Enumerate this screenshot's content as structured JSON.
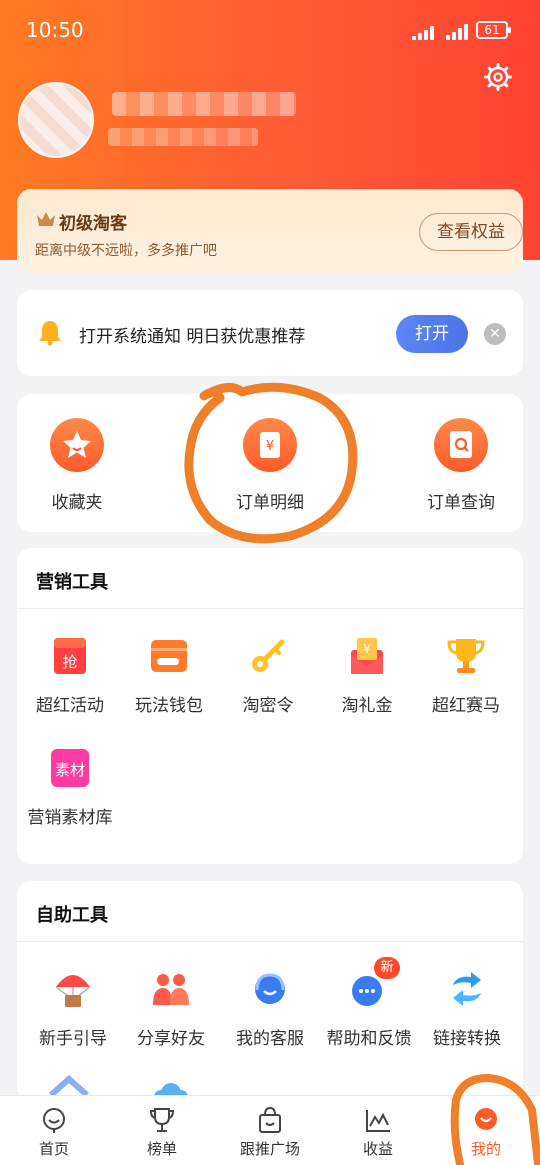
{
  "status_bar": {
    "time": "10:50",
    "battery": "61"
  },
  "profile": {},
  "level": {
    "title": "初级淘客",
    "subtitle": "距离中级不远啦，多多推广吧",
    "button": "查看权益"
  },
  "notice": {
    "text": "打开系统通知 明日获优惠推荐",
    "button": "打开"
  },
  "orders": [
    {
      "label": "收藏夹",
      "icon": "star-icon"
    },
    {
      "label": "订单明细",
      "icon": "order-detail-icon"
    },
    {
      "label": "订单查询",
      "icon": "order-search-icon"
    }
  ],
  "marketing": {
    "title": "营销工具",
    "items": [
      {
        "label": "超红活动",
        "icon": "grab-envelope-icon",
        "glyph": "抢"
      },
      {
        "label": "玩法钱包",
        "icon": "wallet-icon"
      },
      {
        "label": "淘密令",
        "icon": "key-icon"
      },
      {
        "label": "淘礼金",
        "icon": "gift-money-icon",
        "glyph": "¥"
      },
      {
        "label": "超红赛马",
        "icon": "trophy-icon"
      },
      {
        "label": "营销素材库",
        "icon": "material-library-icon",
        "glyph": "素材"
      }
    ]
  },
  "self_service": {
    "title": "自助工具",
    "items": [
      {
        "label": "新手引导",
        "icon": "parachute-icon"
      },
      {
        "label": "分享好友",
        "icon": "share-friends-icon"
      },
      {
        "label": "我的客服",
        "icon": "customer-service-icon"
      },
      {
        "label": "帮助和反馈",
        "icon": "help-feedback-icon",
        "badge": "新"
      },
      {
        "label": "链接转换",
        "icon": "link-convert-icon"
      }
    ]
  },
  "tabs": [
    {
      "label": "首页",
      "icon": "home-face-icon"
    },
    {
      "label": "榜单",
      "icon": "trophy-tab-icon"
    },
    {
      "label": "跟推广场",
      "icon": "shopping-bag-icon"
    },
    {
      "label": "收益",
      "icon": "chart-icon"
    },
    {
      "label": "我的",
      "icon": "profile-icon",
      "active": true
    }
  ],
  "colors": {
    "accent": "#ff5a2a",
    "header_start": "#ff7a22",
    "header_end": "#ff4332",
    "blue_button": "#4c74e8",
    "annotation": "#f07f2a"
  }
}
